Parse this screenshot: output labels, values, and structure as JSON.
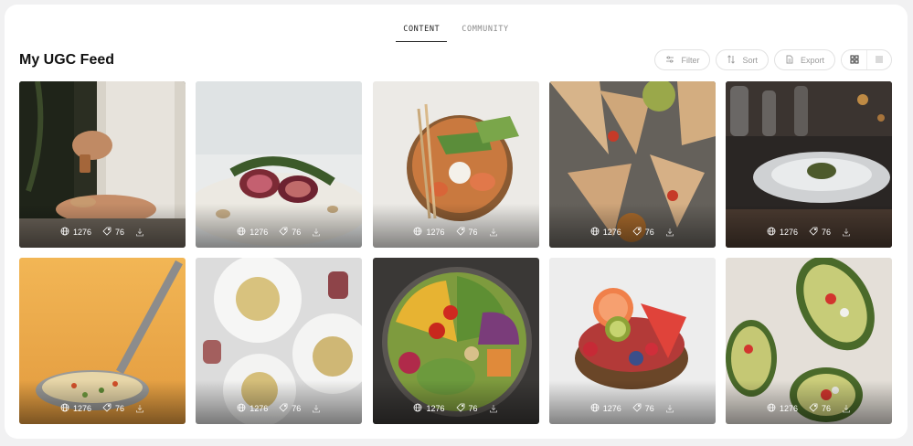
{
  "tabs": [
    {
      "label": "CONTENT",
      "active": true
    },
    {
      "label": "COMMUNITY",
      "active": false
    }
  ],
  "page_title": "My UGC Feed",
  "toolbar": {
    "filter_label": "Filter",
    "sort_label": "Sort",
    "export_label": "Export",
    "view_mode": "grid"
  },
  "cards": [
    {
      "views": "1276",
      "likes": "76",
      "subject": "hand sprinkling spice"
    },
    {
      "views": "1276",
      "likes": "76",
      "subject": "figs with arugula"
    },
    {
      "views": "1276",
      "likes": "76",
      "subject": "poke bowl with chopsticks"
    },
    {
      "views": "1276",
      "likes": "76",
      "subject": "wraps with sauce"
    },
    {
      "views": "1276",
      "likes": "76",
      "subject": "restaurant plated dish"
    },
    {
      "views": "1276",
      "likes": "76",
      "subject": "noodle soup ladle"
    },
    {
      "views": "1276",
      "likes": "76",
      "subject": "pasta plates with wine"
    },
    {
      "views": "1276",
      "likes": "76",
      "subject": "vegetable salad bowl"
    },
    {
      "views": "1276",
      "likes": "76",
      "subject": "fruit coconut bowl"
    },
    {
      "views": "1276",
      "likes": "76",
      "subject": "stuffed avocados"
    }
  ],
  "colors": {
    "accent": "#222222",
    "muted_text": "#9a9a9a",
    "border": "#e2e2e2",
    "background": "#f1f1f2"
  }
}
